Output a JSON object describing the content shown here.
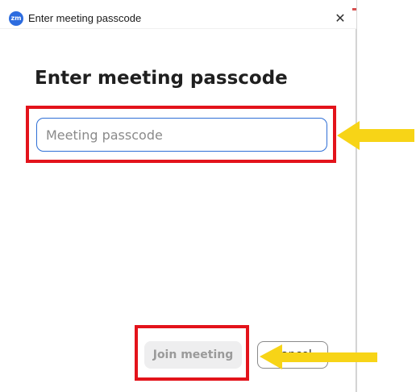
{
  "window": {
    "title": "Enter meeting passcode",
    "app_icon_label": "zm",
    "close_glyph": "✕"
  },
  "dialog": {
    "heading": "Enter meeting passcode",
    "passcode_input": {
      "value": "",
      "placeholder": "Meeting passcode"
    },
    "join_button_label": "Join meeting",
    "cancel_button_label": "Cancel"
  },
  "annotations": {
    "highlight_color": "#e3131b",
    "arrow_color": "#f7d417"
  },
  "colors": {
    "input_border": "#2f6fd6",
    "app_icon": "#2d6cdf",
    "join_button_bg": "#eeeeef",
    "join_button_text": "#9a9a9a"
  }
}
